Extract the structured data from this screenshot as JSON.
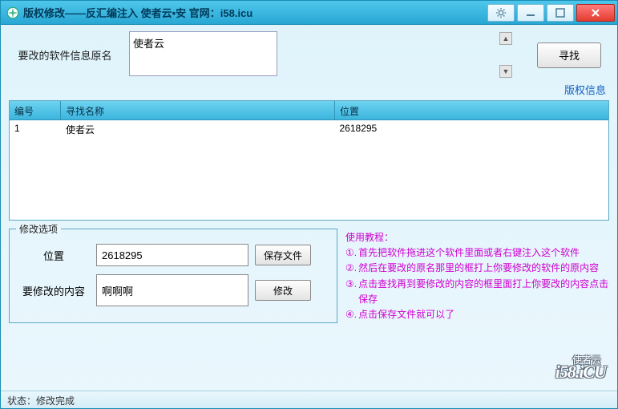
{
  "titlebar": {
    "title": "版权修改——反汇编注入   使者云•安 官网：i58.icu"
  },
  "top": {
    "label": "要改的软件信息原名",
    "textarea_value": "使者云",
    "find_button": "寻找"
  },
  "links": {
    "copyright": "版权信息"
  },
  "table": {
    "headers": {
      "id": "编号",
      "name": "寻找名称",
      "pos": "位置"
    },
    "rows": [
      {
        "id": "1",
        "name": "使者云",
        "pos": "2618295"
      }
    ]
  },
  "edit": {
    "group_title": "修改选项",
    "pos_label": "位置",
    "pos_value": "2618295",
    "save_button": "保存文件",
    "content_label": "要修改的内容",
    "content_value": "啊啊啊",
    "modify_button": "修改"
  },
  "tutorial": {
    "title": "使用教程：",
    "items": [
      "首先把软件拖进这个软件里面或者右键注入这个软件",
      "然后在要改的原名那里的框打上你要修改的软件的原内容",
      "点击查找再到要修改的内容的框里面打上你要改的内容点击保存",
      "点击保存文件就可以了"
    ],
    "nums": [
      "①.",
      "②.",
      "③.",
      "④."
    ]
  },
  "watermark": {
    "small": "使者云",
    "big": "i58.iCU"
  },
  "status": {
    "label": "状态：",
    "value": "修改完成"
  }
}
